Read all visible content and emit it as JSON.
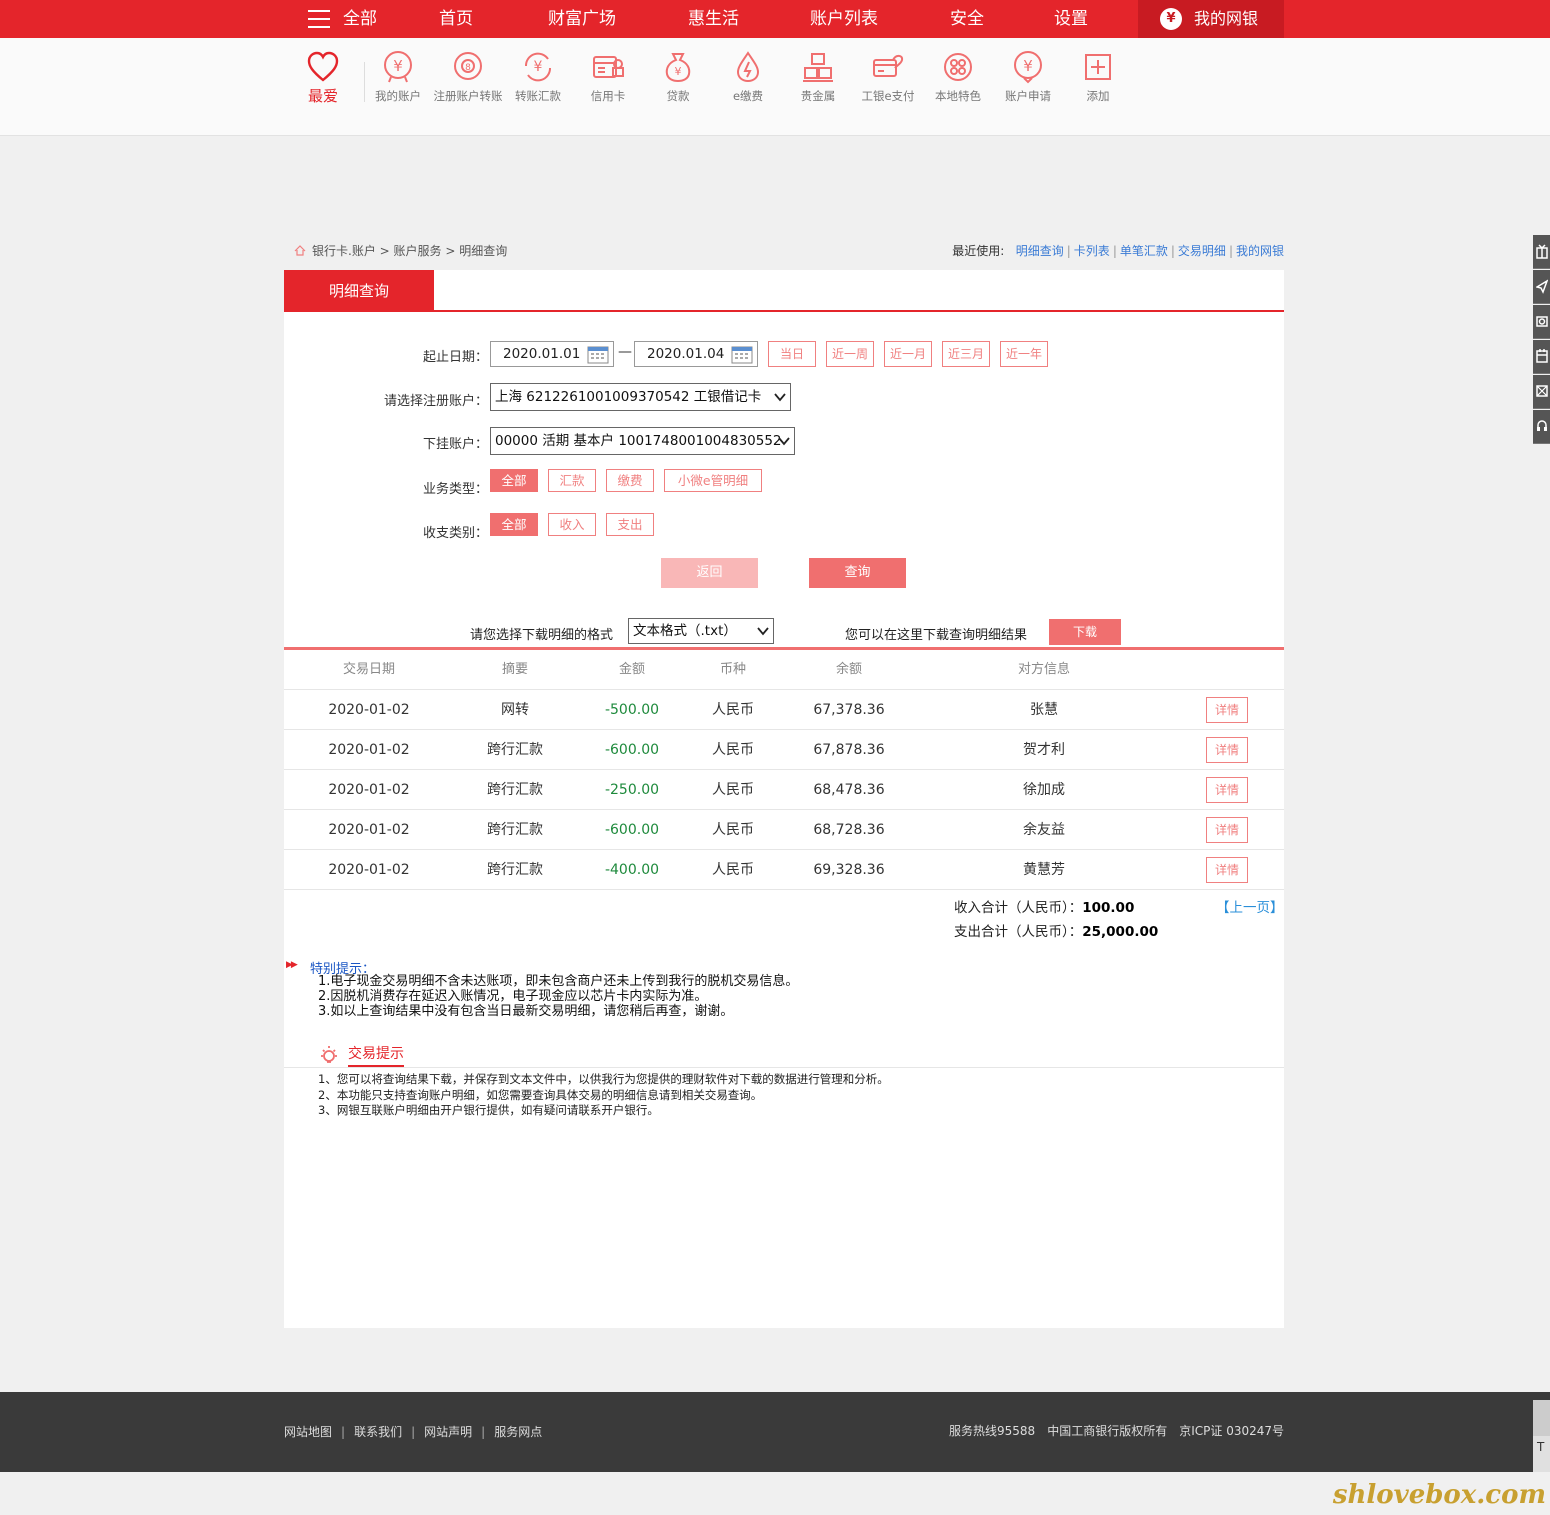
{
  "nav": {
    "all_label": "全部",
    "items": [
      "首页",
      "财富广场",
      "惠生活",
      "账户列表",
      "安全",
      "设置"
    ],
    "mybank_label": "我的网银"
  },
  "favorites": {
    "love_label": "最爱",
    "items": [
      "我的账户",
      "注册账户转账",
      "转账汇款",
      "信用卡",
      "贷款",
      "e缴费",
      "贵金属",
      "工银e支付",
      "本地特色",
      "账户申请",
      "添加"
    ]
  },
  "breadcrumb": {
    "items": [
      "银行卡.账户",
      "账户服务",
      "明细查询"
    ]
  },
  "recent": {
    "label": "最近使用:",
    "links": [
      "明细查询",
      "卡列表",
      "单笔汇款",
      "交易明细",
      "我的网银"
    ]
  },
  "tab": {
    "active": "明细查询"
  },
  "form": {
    "date_label": "起止日期：",
    "date_from": "2020.01.01",
    "date_to": "2020.01.04",
    "quick_ranges": [
      "当日",
      "近一周",
      "近一月",
      "近三月",
      "近一年"
    ],
    "account_label": "请选择注册账户：",
    "account_value": "上海 6212261001009370542 工银借记卡",
    "sub_account_label": "下挂账户：",
    "sub_account_value": "00000 活期 基本户 1001748001004830552",
    "biz_type_label": "业务类型：",
    "biz_types": [
      "全部",
      "汇款",
      "缴费",
      "小微e管明细"
    ],
    "io_type_label": "收支类别：",
    "io_types": [
      "全部",
      "收入",
      "支出"
    ],
    "back_button": "返回",
    "query_button": "查询"
  },
  "download": {
    "format_label": "请您选择下载明细的格式",
    "format_value": "文本格式（.txt）",
    "hint": "您可以在这里下载查询明细结果",
    "button": "下载"
  },
  "table": {
    "headers": [
      "交易日期",
      "摘要",
      "金额",
      "币种",
      "余额",
      "对方信息"
    ],
    "detail_label": "详情",
    "rows": [
      {
        "date": "2020-01-02",
        "summary": "网转",
        "amount": "-500.00",
        "currency": "人民币",
        "balance": "67,378.36",
        "party": "张慧"
      },
      {
        "date": "2020-01-02",
        "summary": "跨行汇款",
        "amount": "-600.00",
        "currency": "人民币",
        "balance": "67,878.36",
        "party": "贺才利"
      },
      {
        "date": "2020-01-02",
        "summary": "跨行汇款",
        "amount": "-250.00",
        "currency": "人民币",
        "balance": "68,478.36",
        "party": "徐加成"
      },
      {
        "date": "2020-01-02",
        "summary": "跨行汇款",
        "amount": "-600.00",
        "currency": "人民币",
        "balance": "68,728.36",
        "party": "余友益"
      },
      {
        "date": "2020-01-02",
        "summary": "跨行汇款",
        "amount": "-400.00",
        "currency": "人民币",
        "balance": "69,328.36",
        "party": "黄慧芳"
      }
    ]
  },
  "totals": {
    "income_label": "收入合计（人民币）：",
    "income_value": "100.00",
    "expense_label": "支出合计（人民币）：",
    "expense_value": "25,000.00",
    "prev_page": "【上一页】"
  },
  "notice": {
    "title": "特别提示：",
    "lines": [
      "1.电子现金交易明细不含未达账项，即未包含商户还未上传到我行的脱机交易信息。",
      "2.因脱机消费存在延迟入账情况，电子现金应以芯片卡内实际为准。",
      "3.如以上查询结果中没有包含当日最新交易明细，请您稍后再查，谢谢。"
    ]
  },
  "tips": {
    "title": "交易提示",
    "lines": [
      "1、您可以将查询结果下载，并保存到文本文件中，以供我行为您提供的理财软件对下载的数据进行管理和分析。",
      "2、本功能只支持查询账户明细，如您需要查询具体交易的明细信息请到相关交易查询。",
      "3、网银互联账户明细由开户银行提供，如有疑问请联系开户银行。"
    ]
  },
  "footer": {
    "links": [
      "网站地图",
      "联系我们",
      "网站声明",
      "服务网点"
    ],
    "hotline": "服务热线95588",
    "copyright": "中国工商银行版权所有",
    "icp": "京ICP证 030247号"
  },
  "watermark": "shlovebox.com",
  "colors": {
    "brand_red": "#e4252b",
    "light_red": "#f06f6f",
    "negative_green": "#1e8a3c",
    "link_blue": "#3a7bd5"
  }
}
